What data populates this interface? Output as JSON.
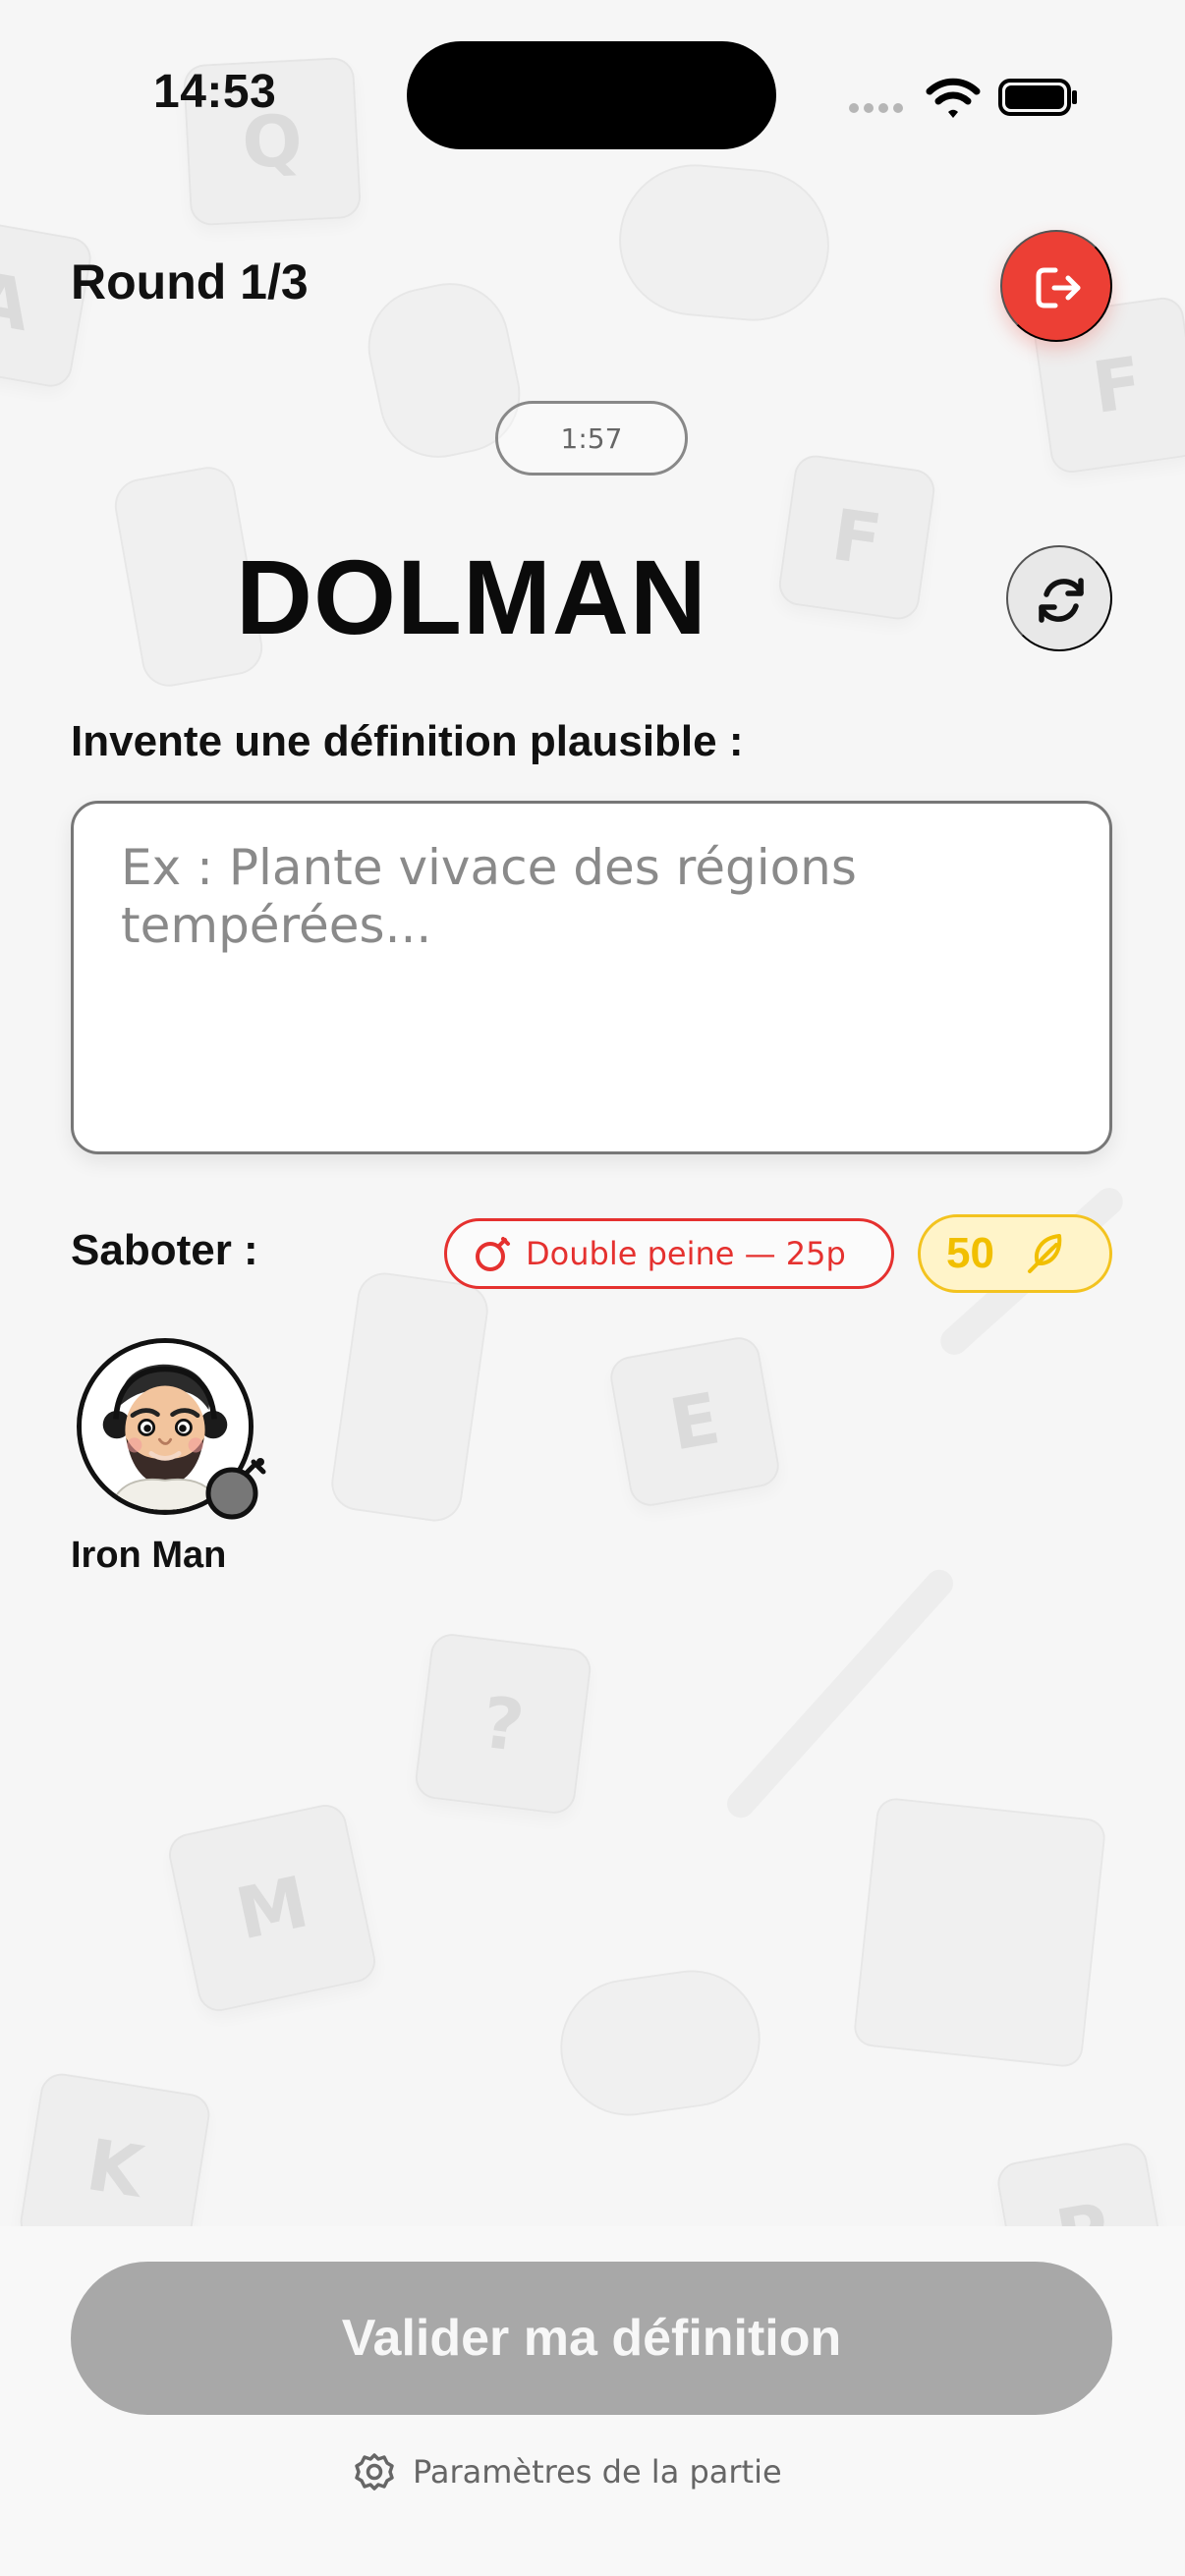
{
  "status_bar": {
    "time": "14:53"
  },
  "header": {
    "round": "Round 1/3",
    "exit_icon": "logout-icon"
  },
  "timer": {
    "label": "1:57"
  },
  "word": {
    "value": "DOLMAN",
    "refresh_icon": "refresh-icon"
  },
  "definition": {
    "label": "Invente une définition plausible :",
    "placeholder": "Ex : Plante vivace des régions tempérées...",
    "value": ""
  },
  "sabotage": {
    "label": "Saboter :",
    "option": "Double peine — 25p",
    "option_icon": "bomb-icon",
    "points": "50",
    "points_icon": "feather-icon"
  },
  "players": [
    {
      "name": "Iron Man",
      "avatar": "bearded-player-avatar",
      "status_icon": "bomb-icon"
    }
  ],
  "footer": {
    "validate": "Valider ma définition",
    "settings": "Paramètres de la partie",
    "settings_icon": "gear-icon"
  },
  "colors": {
    "primary_red": "#ec3f35",
    "gold": "#f1bf00",
    "disabled_button": "#a8a8a8"
  }
}
